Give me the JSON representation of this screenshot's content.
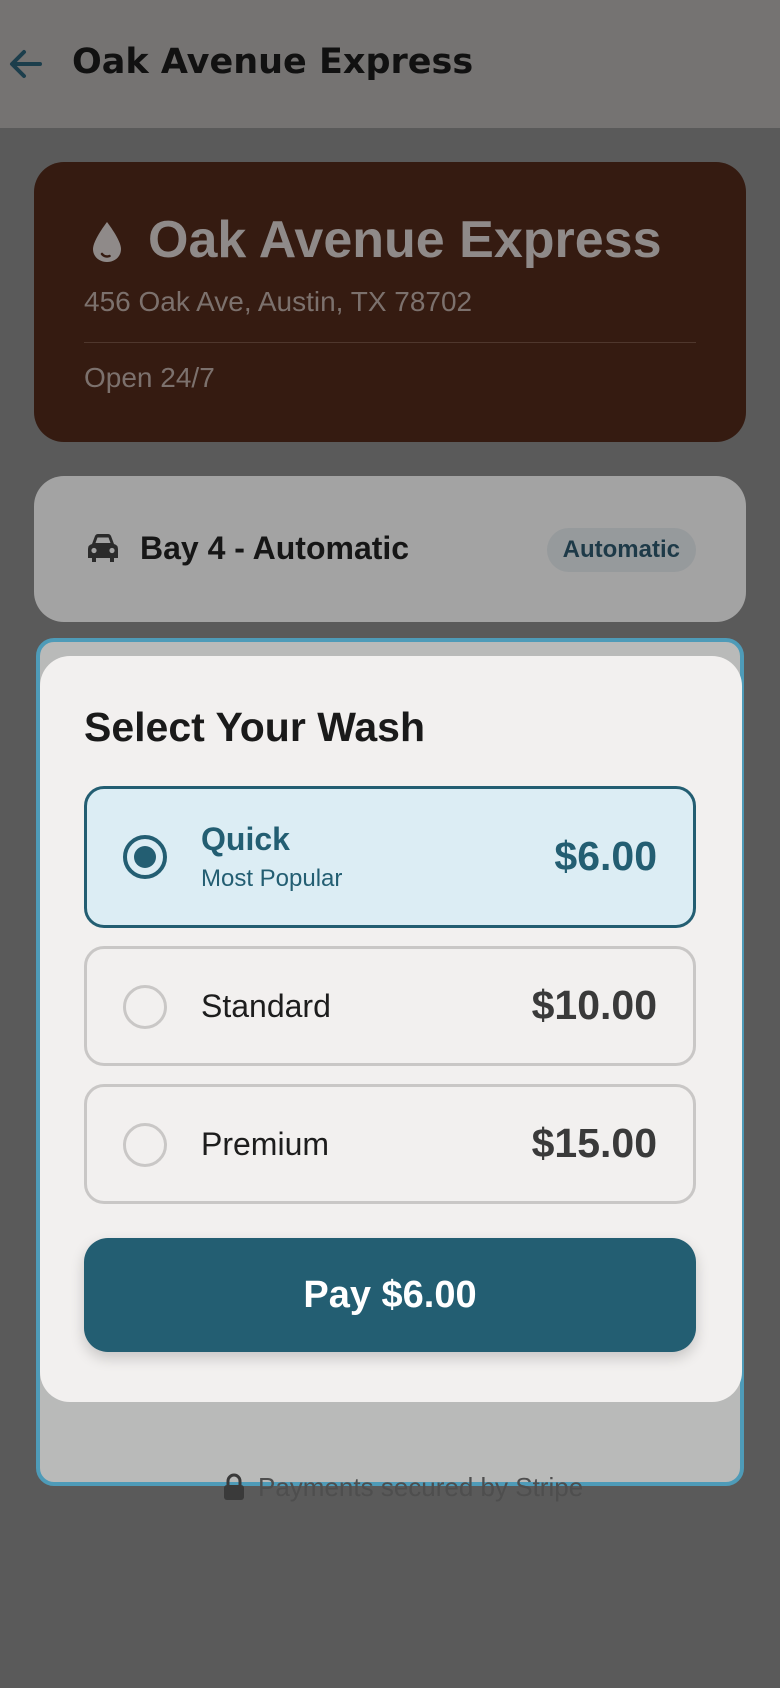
{
  "header": {
    "title": "Oak Avenue Express",
    "back_icon": "arrow-left-icon"
  },
  "station": {
    "icon": "water-drop-icon",
    "name": "Oak Avenue Express",
    "address": "456 Oak Ave, Austin, TX 78702",
    "hours": "Open 24/7"
  },
  "bay": {
    "icon": "car-icon",
    "name": "Bay 4 - Automatic",
    "badge": "Automatic"
  },
  "wash_sheet": {
    "title": "Select Your Wash",
    "options": [
      {
        "name": "Quick",
        "subtitle": "Most Popular",
        "price": "$6.00",
        "selected": true
      },
      {
        "name": "Standard",
        "subtitle": "",
        "price": "$10.00",
        "selected": false
      },
      {
        "name": "Premium",
        "subtitle": "",
        "price": "$15.00",
        "selected": false
      }
    ],
    "pay_label": "Pay $6.00"
  },
  "footer": {
    "icon": "lock-icon",
    "secure_text": "Payments secured by Stripe"
  },
  "colors": {
    "accent": "#235e72",
    "selected_bg": "#dcedf4",
    "station_card_bg": "#351b11",
    "overlay_bg": "#5a5a5a",
    "highlight_border": "#4e9bb8"
  }
}
